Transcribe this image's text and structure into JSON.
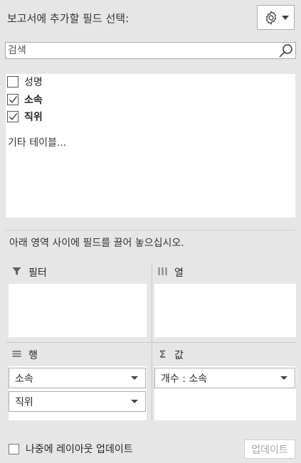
{
  "header": {
    "title": "보고서에 추가할 필드 선택:",
    "tools_icon": "gear-icon"
  },
  "search": {
    "placeholder": "검색",
    "icon": "search-icon"
  },
  "fields": [
    {
      "label": "성명",
      "checked": false
    },
    {
      "label": "소속",
      "checked": true
    },
    {
      "label": "직위",
      "checked": true
    }
  ],
  "more_tables": "기타 테이블...",
  "instruction": "아래 영역 사이에 필드를 끌어 놓으십시오.",
  "areas": {
    "filters": {
      "label": "필터",
      "icon": "filter-icon",
      "items": []
    },
    "columns": {
      "label": "열",
      "icon": "columns-icon",
      "items": []
    },
    "rows": {
      "label": "행",
      "icon": "rows-icon",
      "items": [
        "소속",
        "직위"
      ]
    },
    "values": {
      "label": "값",
      "icon": "sigma-icon",
      "items": [
        "개수 : 소속"
      ]
    }
  },
  "footer": {
    "defer_label": "나중에 레이아웃 업데이트",
    "defer_checked": false,
    "update_label": "업데이트"
  }
}
